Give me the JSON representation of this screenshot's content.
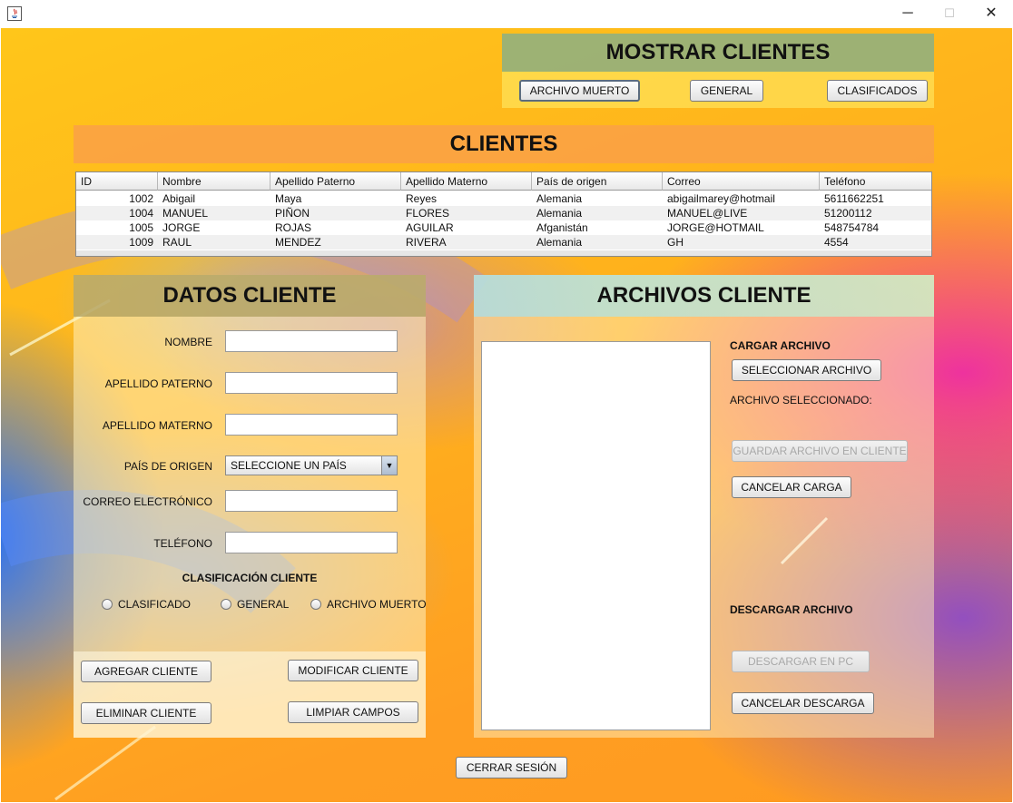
{
  "window": {
    "minimize_glyph": "─",
    "maximize_glyph": "☐",
    "close_glyph": "✕"
  },
  "mostrar": {
    "title": "MOSTRAR CLIENTES",
    "btn_archivo_muerto": "ARCHIVO MUERTO",
    "btn_general": "GENERAL",
    "btn_clasificados": "CLASIFICADOS"
  },
  "clientes": {
    "title": "CLIENTES",
    "columns": [
      "ID",
      "Nombre",
      "Apellido Paterno",
      "Apellido Materno",
      "País de origen",
      "Correo",
      "Teléfono"
    ],
    "rows": [
      [
        "1002",
        "Abigail",
        "Maya",
        "Reyes",
        "Alemania",
        "abigailmarey@hotmail",
        "5611662251"
      ],
      [
        "1004",
        "MANUEL",
        "PIÑON",
        "FLORES",
        "Alemania",
        "MANUEL@LIVE",
        "51200112"
      ],
      [
        "1005",
        "JORGE",
        "ROJAS",
        "AGUILAR",
        "Afganistán",
        "JORGE@HOTMAIL",
        "548754784"
      ],
      [
        "1009",
        "RAUL",
        "MENDEZ",
        "RIVERA",
        "Alemania",
        "GH",
        "4554"
      ]
    ]
  },
  "datos": {
    "title": "DATOS CLIENTE",
    "label_nombre": "NOMBRE",
    "label_apellido_paterno": "APELLIDO PATERNO",
    "label_apellido_materno": "APELLIDO MATERNO",
    "label_pais": "PAÍS DE ORIGEN",
    "pais_selected": "SELECCIONE UN PAÍS",
    "label_correo": "CORREO ELECTRÓNICO",
    "label_telefono": "TELÉFONO",
    "clasificacion_title": "CLASIFICACIÓN CLIENTE",
    "radio_clasificado": "CLASIFICADO",
    "radio_general": "GENERAL",
    "radio_archivo_muerto": "ARCHIVO MUERTO",
    "btn_agregar": "AGREGAR CLIENTE",
    "btn_modificar": "MODIFICAR CLIENTE",
    "btn_eliminar": "ELIMINAR CLIENTE",
    "btn_limpiar": "LIMPIAR CAMPOS"
  },
  "archivos": {
    "title": "ARCHIVOS CLIENTE",
    "cargar_title": "CARGAR ARCHIVO",
    "btn_seleccionar": "SELECCIONAR ARCHIVO",
    "archivo_seleccionado": "ARCHIVO SELECCIONADO:",
    "btn_guardar": "GUARDAR ARCHIVO EN CLIENTE",
    "btn_cancelar_carga": "CANCELAR CARGA",
    "descargar_title": "DESCARGAR ARCHIVO",
    "btn_descargar": "DESCARGAR EN PC",
    "btn_cancelar_descarga": "CANCELAR DESCARGA"
  },
  "footer": {
    "btn_cerrar_sesion": "CERRAR SESIÓN"
  }
}
